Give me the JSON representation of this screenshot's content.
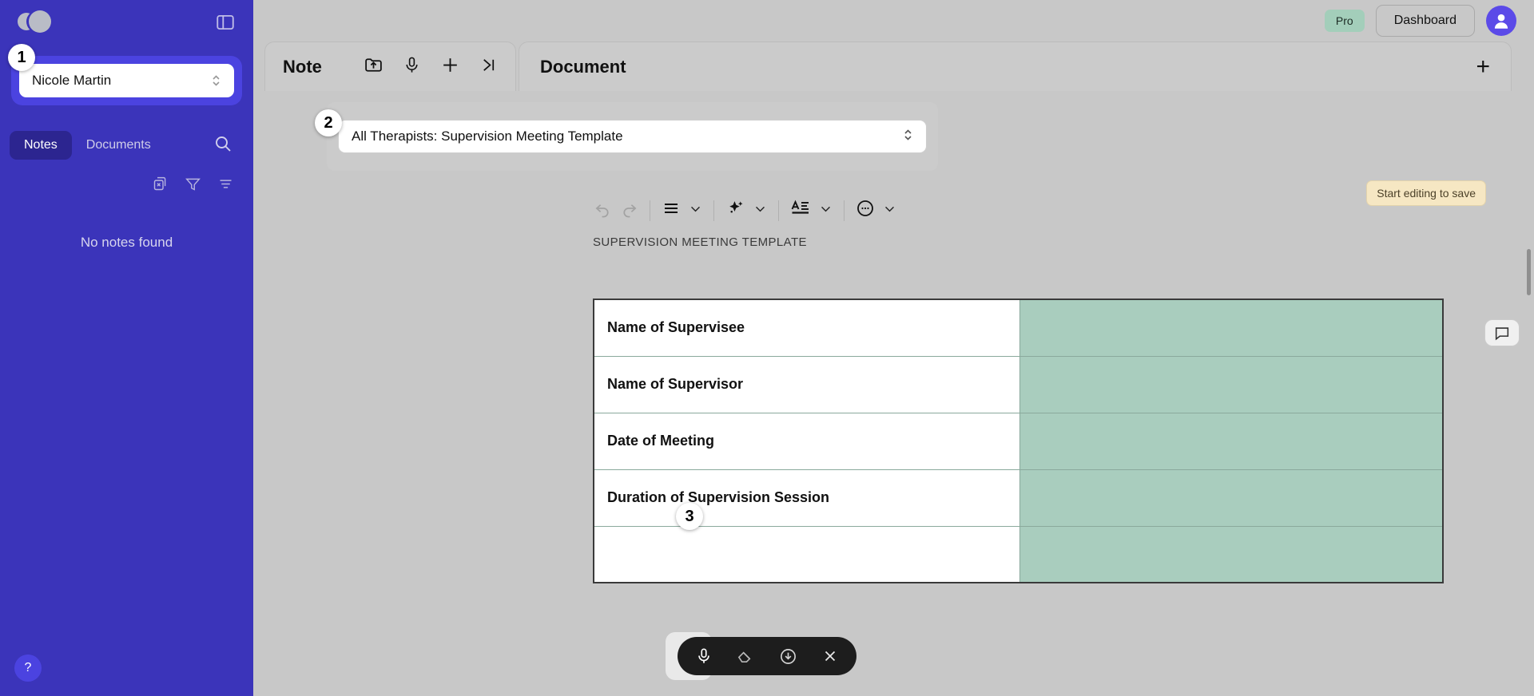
{
  "sidebar": {
    "logo_name": "app-logo",
    "panel_toggle": "panel-toggle-icon",
    "user": {
      "name": "Nicole Martin"
    },
    "tabs": [
      {
        "label": "Notes",
        "active": true
      },
      {
        "label": "Documents",
        "active": false
      }
    ],
    "search_icon": "search-icon",
    "tools": [
      "copy-disabled-icon",
      "filter-icon",
      "sort-icon"
    ],
    "empty_state": "No notes found",
    "help_label": "?"
  },
  "topbar": {
    "plan_badge": "Pro",
    "dashboard_label": "Dashboard",
    "avatar": "user-avatar"
  },
  "note_panel": {
    "title": "Note",
    "icons": [
      "folder-upload-icon",
      "microphone-icon",
      "plus-icon",
      "collapse-right-icon"
    ]
  },
  "document_panel": {
    "title": "Document",
    "add_label": "+"
  },
  "template": {
    "selected": "All Therapists: Supervision Meeting Template"
  },
  "save_hint": "Start editing to save",
  "editor_toolbar": {
    "undo": "undo-icon",
    "redo": "redo-icon",
    "list": "list-icon",
    "ai": "ai-sparkle-icon",
    "text_format": "text-format-icon",
    "emoji": "emoji-icon"
  },
  "document": {
    "subtitle": "SUPERVISION MEETING TEMPLATE",
    "rows": [
      {
        "label": "Name of Supervisee",
        "value": ""
      },
      {
        "label": "Name of Supervisor",
        "value": ""
      },
      {
        "label": "Date of Meeting",
        "value": ""
      },
      {
        "label": "Duration of Supervision Session",
        "value": ""
      },
      {
        "label": "",
        "value": ""
      }
    ]
  },
  "float_toolbar": {
    "mic": "microphone-icon",
    "erase": "erase-icon",
    "download": "download-icon",
    "close": "close-icon"
  },
  "comment_button": "comment-icon",
  "callouts": [
    {
      "number": "1"
    },
    {
      "number": "2"
    },
    {
      "number": "3"
    }
  ],
  "colors": {
    "sidebar": "#3b34ba",
    "sidebar_accent": "#4b43e0",
    "pro_badge": "#a3ceba",
    "table_fill": "#a9cdbe",
    "canvas": "#c8c8c8"
  }
}
